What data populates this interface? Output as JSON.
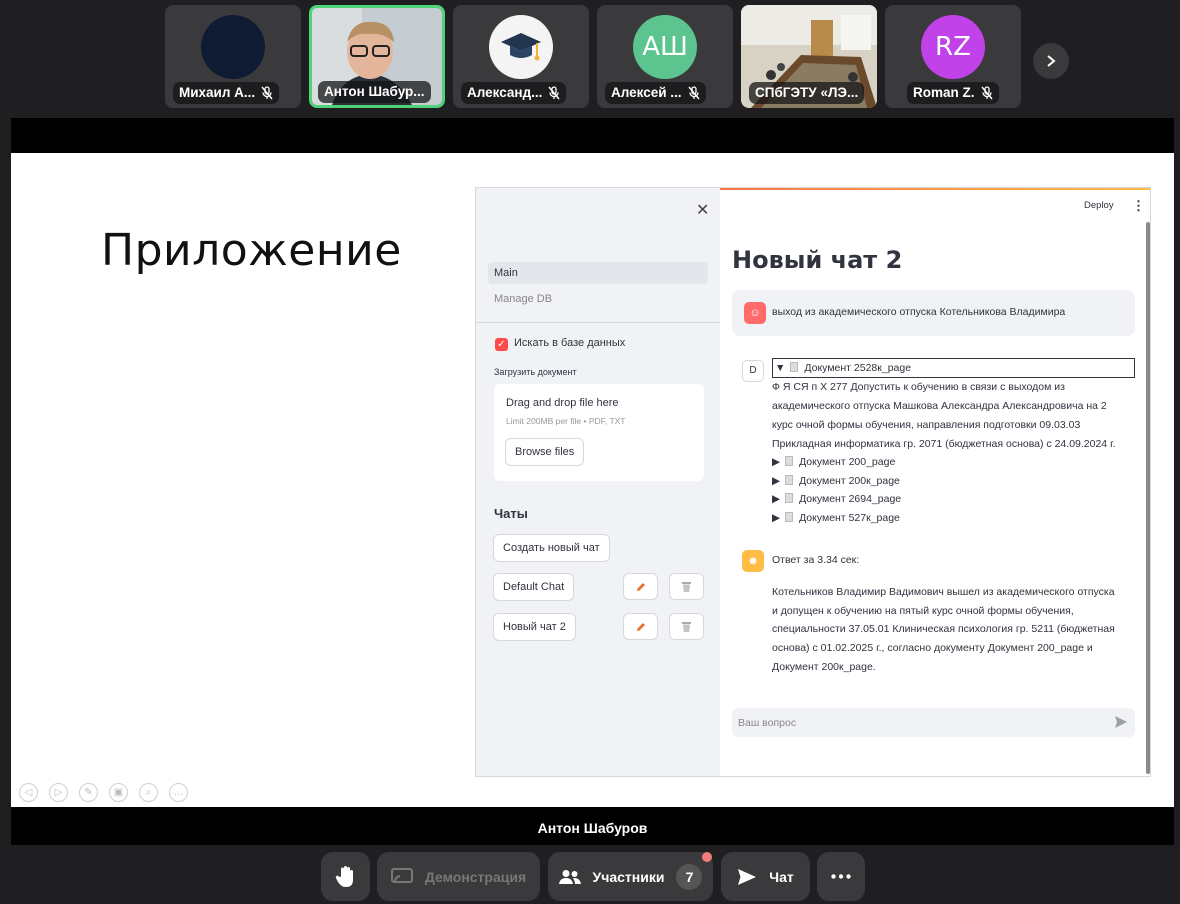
{
  "participants": [
    {
      "name": "Михаил А...",
      "initials": "",
      "avatar_color": "#0f1a33",
      "muted": true,
      "active": false
    },
    {
      "name": "Антон Шабур...",
      "initials": "",
      "avatar_color": "#7a8a96",
      "muted": false,
      "active": true
    },
    {
      "name": "Александ...",
      "initials": "",
      "avatar_color": "#f4f4f4",
      "muted": true,
      "active": false
    },
    {
      "name": "Алексей ...",
      "initials": "АШ",
      "avatar_color": "#5cc48e",
      "muted": true,
      "active": false
    },
    {
      "name": "СПбГЭТУ «ЛЭ...",
      "initials": "",
      "avatar_color": "#8d7a5c",
      "muted": false,
      "active": false
    },
    {
      "name": "Roman Z.",
      "initials": "RZ",
      "avatar_color": "#c042e8",
      "muted": true,
      "active": false
    }
  ],
  "slide": {
    "title": "Приложение"
  },
  "app": {
    "sidebar": {
      "nav": [
        "Main",
        "Manage DB"
      ],
      "search_db_label": "Искать в базе данных",
      "upload_label": "Загрузить документ",
      "dropzone_title": "Drag and drop file here",
      "dropzone_limit": "Limit 200MB per file • PDF, TXT",
      "browse_label": "Browse files",
      "chats_heading": "Чаты",
      "new_chat_label": "Создать новый чат",
      "chats": [
        "Default Chat",
        "Новый чат 2"
      ]
    },
    "header": {
      "deploy": "Deploy"
    },
    "chat": {
      "title": "Новый чат 2",
      "user_message": "выход из академического отпуска Котельникова Владимира",
      "doc_avatar": "D",
      "expanded_doc": "Документ 2528к_page",
      "doc_text": [
        "Ф Я СЯ п Х 277 Допустить к обучению в связи с выходом из",
        "академического отпуска Машкова Александра Александровича на 2",
        "курс очной формы обучения, направления подготовки 09.03.03",
        "Прикладная информатика гр. 2071 (бюджетная основа) с 24.09.2024 г."
      ],
      "collapsed_docs": [
        "Документ 200_page",
        "Документ 200к_page",
        "Документ 2694_page",
        "Документ 527к_page"
      ],
      "answer_time": "Ответ за 3.34 сек:",
      "answer_text": [
        "Котельников Владимир Вадимович вышел из академического отпуска",
        "и допущен к обучению на пятый курс очной формы обучения,",
        "специальности 37.05.01 Клиническая психология гр. 5211 (бюджетная",
        "основа) с 01.02.2025 г., согласно документу Документ 200_page и",
        "Документ 200к_page."
      ],
      "input_placeholder": "Ваш вопрос"
    }
  },
  "speaker_caption": "Антон Шабуров",
  "controls": {
    "demo_label": "Демонстрация",
    "participants_label": "Участники",
    "participants_count": "7",
    "chat_label": "Чат"
  }
}
